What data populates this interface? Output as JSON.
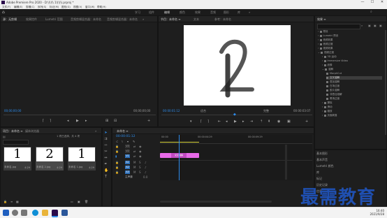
{
  "app": {
    "title": "Adobe Premiere Pro 2020 - D:\\(\\)\\\\ 1\\(\\)\\\\.prproj *",
    "window_controls": [
      "—",
      "☐",
      "✕"
    ]
  },
  "menu": [
    "文件(F)",
    "编辑(E)",
    "剪辑(C)",
    "序列(S)",
    "标记(M)",
    "图形(G)",
    "视图(V)",
    "窗口(W)",
    "帮助(H)"
  ],
  "workspaces": {
    "items": [
      "学习",
      "组件",
      "编辑",
      "颜色",
      "效果",
      "音频",
      "图形",
      "库",
      "»"
    ],
    "active": 3
  },
  "source_panel": {
    "tabs": [
      "源：无剪辑",
      "效果控件",
      "Lumetri 范围",
      "音频剪辑混合器：未命名",
      "音频剪辑混合器：未命名",
      "»"
    ],
    "timecode_left": "00;00;00;00",
    "timecode_right": "00;00;00;00"
  },
  "program_panel": {
    "tabs": [
      "节目：未命名 ≡",
      "文本",
      "参考：未命名"
    ],
    "timecode": "00:00:01:12",
    "fit": "适合",
    "quality": "完整",
    "duration": "00:00:03:07",
    "frame_glyph": "2"
  },
  "project_panel": {
    "tabs": [
      "项目：未命名 ≡",
      "媒体浏览器",
      "»"
    ],
    "status": "1 项已选择，共 4 项",
    "items": [
      {
        "glyph": "1",
        "name": "未命名.jpg",
        "duration": "4:29"
      },
      {
        "glyph": "2",
        "name": "未命名 2.jpg",
        "duration": "4:29"
      },
      {
        "glyph": "1",
        "name": "未命名 1.jpg",
        "duration": "4:29"
      }
    ]
  },
  "timeline": {
    "tab": "未命名 ≡",
    "timecode": "00:00:01:12",
    "ruler": [
      "00:00",
      "00:00:04:29",
      "00:00:09:29"
    ],
    "tracks": [
      {
        "label": "V3",
        "target": "V3"
      },
      {
        "label": "V2",
        "target": "V2"
      },
      {
        "label": "V1",
        "target": "V1"
      },
      {
        "label": "A1",
        "target": "A1"
      },
      {
        "label": "A2",
        "target": "A2"
      },
      {
        "label": "A3",
        "target": "A3"
      },
      {
        "label": "主声道",
        "target": ""
      }
    ],
    "clip_label": "交叉溶解"
  },
  "effects_panel": {
    "title": "效果 ≡",
    "search_placeholder": "",
    "tree": [
      "预设",
      "Lumetri 预设",
      "音频效果",
      "音频过渡",
      "视频效果",
      "视频过渡",
      "3D 运动",
      "Immersive Video",
      "划像",
      "溶解",
      "MorphCut",
      "交叉溶解",
      "叠加溶解",
      "白场过渡",
      "胶片溶解",
      "非叠加溶解",
      "黑场过渡",
      "擦除",
      "滑动",
      "缩放",
      "页面剥落"
    ],
    "selected_index": 11,
    "lower_items": [
      "基本图形",
      "基本声音",
      "Lumetri 颜色",
      "库",
      "标记",
      "历史记录",
      "信息"
    ]
  },
  "taskbar": {
    "time": "16:40",
    "date": "2021/9/28",
    "icons": [
      {
        "name": "windows-start",
        "color": "#1f5fbf"
      },
      {
        "name": "search",
        "color": "#777777"
      },
      {
        "name": "task-view",
        "color": "#777777"
      },
      {
        "name": "edge",
        "color": "#0f8fd6"
      },
      {
        "name": "explorer",
        "color": "#e9b43a"
      },
      {
        "name": "premiere",
        "color": "#2a0a4a"
      },
      {
        "name": "word",
        "color": "#2b579a"
      }
    ]
  },
  "watermark": "最需教育",
  "colors": {
    "accent": "#2d8ceb",
    "clip": "#e86ae8",
    "playhead": "#2d8ceb",
    "in_out": "#d6d23a"
  }
}
